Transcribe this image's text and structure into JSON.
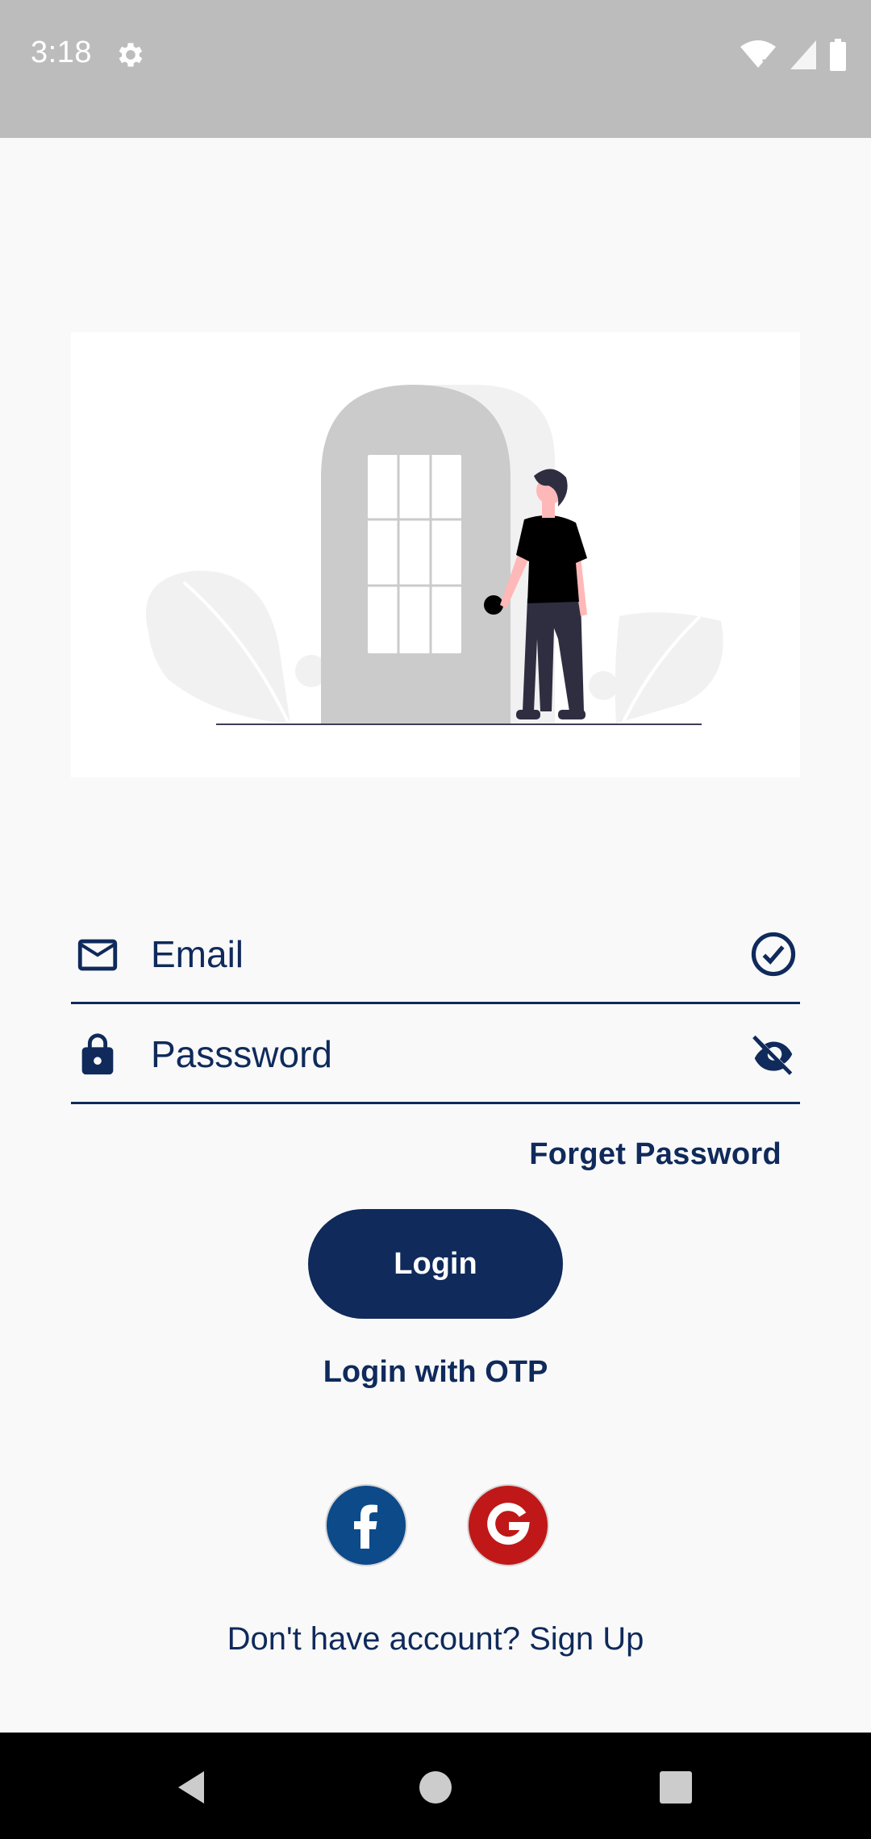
{
  "status_bar": {
    "time": "3:18",
    "icons": [
      "gear-icon",
      "wifi-off-icon",
      "signal-icon",
      "battery-icon"
    ]
  },
  "illustration": {
    "description_icon": "door-person-illustration"
  },
  "form": {
    "email": {
      "placeholder": "Email",
      "value": "",
      "leading_icon": "mail-icon",
      "trailing_icon": "check-circle-icon"
    },
    "password": {
      "placeholder": "Passsword",
      "value": "",
      "leading_icon": "lock-icon",
      "trailing_icon": "eye-off-icon"
    },
    "forget_password_label": "Forget Password",
    "login_label": "Login",
    "otp_label": "Login with OTP"
  },
  "social": {
    "facebook_icon": "facebook-icon",
    "google_icon": "google-icon"
  },
  "footer": {
    "signup_text": "Don't have account? Sign Up"
  },
  "colors": {
    "primary": "#0f2a5b",
    "status_bar": "#bcbcbc",
    "background": "#f9f9f9",
    "facebook": "#0c4a8a",
    "google": "#c01818"
  }
}
